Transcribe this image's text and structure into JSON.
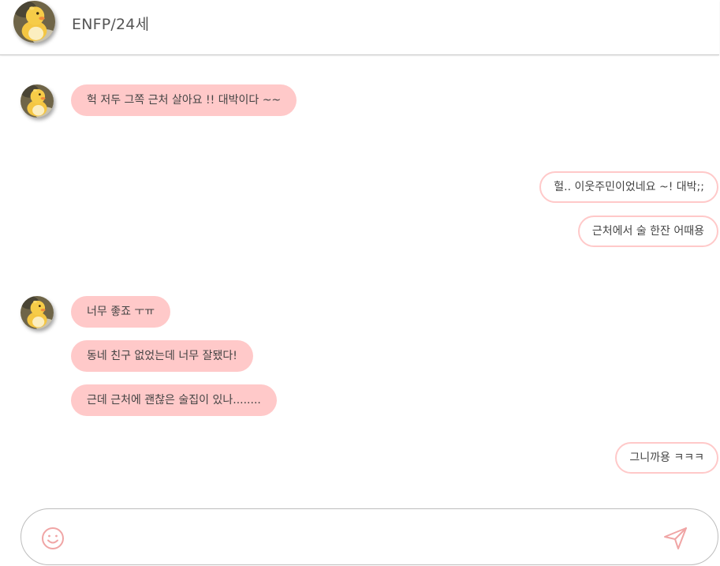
{
  "header": {
    "title": "ENFP/24세"
  },
  "messages": [
    {
      "side": "in",
      "text": "헉 저두 그쪽 근처 살아요 !! 대박이다 ~~"
    },
    {
      "side": "out",
      "text": "헐.. 이웃주민이었네요 ~! 대박;;"
    },
    {
      "side": "out",
      "text": "근처에서 술 한잔 어때용"
    },
    {
      "side": "in",
      "text": "너무 좋죠 ㅜㅠ"
    },
    {
      "side": "in",
      "text": "동네 친구 없었는데 너무 잘됐다!"
    },
    {
      "side": "in",
      "text": "근데 근처에 괜찮은 술집이 있나........"
    },
    {
      "side": "out",
      "text": "그니까용 ㅋㅋㅋ"
    }
  ],
  "composer": {
    "value": "",
    "emoji_icon": "smile-icon",
    "send_icon": "send-icon"
  },
  "colors": {
    "incoming_bubble": "#ffc9c9",
    "outgoing_border": "#ffc9c9",
    "icon": "#f0a5a5"
  }
}
